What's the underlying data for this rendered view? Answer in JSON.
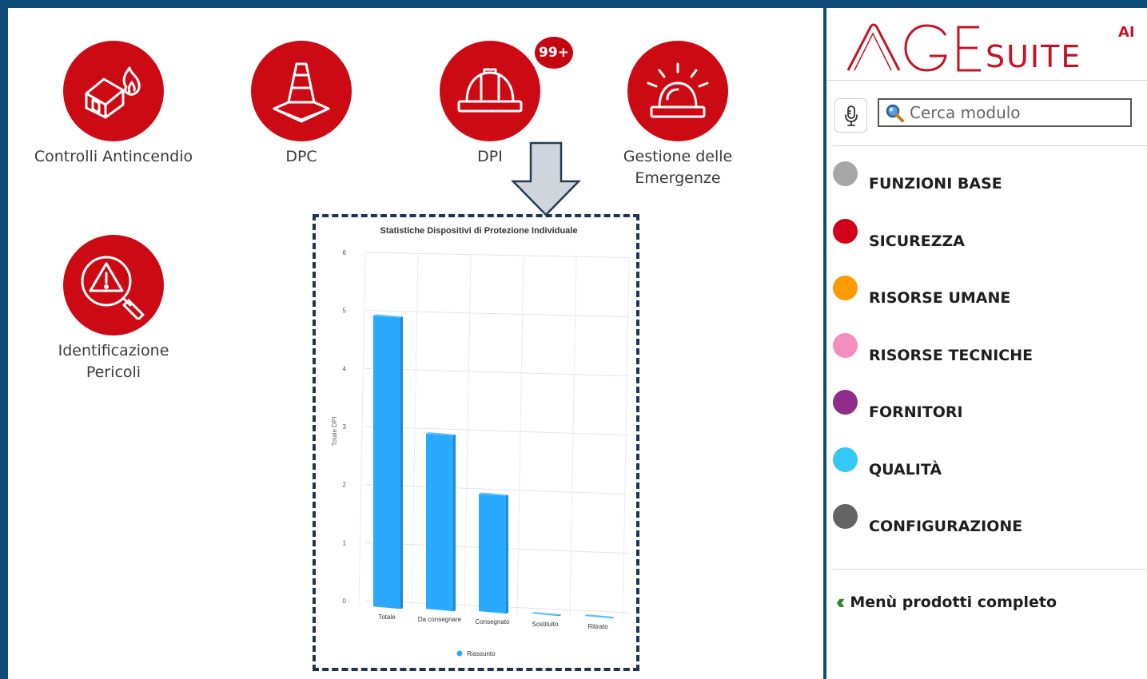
{
  "modules": [
    {
      "label": "Controlli Antincendio",
      "icon": "house-fire-icon"
    },
    {
      "label": "DPC",
      "icon": "traffic-cone-icon"
    },
    {
      "label": "DPI",
      "icon": "hard-hat-icon",
      "badge": "99+"
    },
    {
      "label": "Gestione delle\nEmergenze",
      "icon": "alarm-light-icon"
    },
    {
      "label": "Identificazione\nPericoli",
      "icon": "hazard-search-icon"
    }
  ],
  "chart_data": {
    "type": "bar",
    "title": "Statistiche Dispositivi di Protezione Individuale",
    "categories": [
      "Totale",
      "Da consegnare",
      "Consegnato",
      "Sostituito",
      "Ritirato"
    ],
    "series": [
      {
        "name": "Riassunto",
        "values": [
          5,
          3,
          2,
          0,
          0
        ],
        "color": "#29aaff"
      }
    ],
    "ylabel": "Totale DPI",
    "ylim": [
      0,
      6
    ],
    "yticks": [
      "0",
      "1",
      "2",
      "3",
      "4",
      "5",
      "6"
    ],
    "grid": true,
    "legend": "bottom"
  },
  "sidebar": {
    "logo": {
      "brand": "AGE",
      "suffix": "SUITE",
      "superscript": "AI",
      "color": "#c41424"
    },
    "search": {
      "placeholder": "Cerca modulo",
      "value": ""
    },
    "menu": [
      {
        "label": "FUNZIONI BASE",
        "color": "#a6a6a6"
      },
      {
        "label": "SICUREZZA",
        "color": "#d0021b"
      },
      {
        "label": "RISORSE UMANE",
        "color": "#ff9a00"
      },
      {
        "label": "RISORSE TECNICHE",
        "color": "#f28fbf"
      },
      {
        "label": "FORNITORI",
        "color": "#8e2e88"
      },
      {
        "label": "QUALITÀ",
        "color": "#34c8f5"
      },
      {
        "label": "CONFIGURAZIONE",
        "color": "#646464"
      }
    ],
    "full_menu_label": "Menù prodotti completo"
  },
  "colors": {
    "frame": "#0f4c7a",
    "module_red": "#cc0a14"
  }
}
